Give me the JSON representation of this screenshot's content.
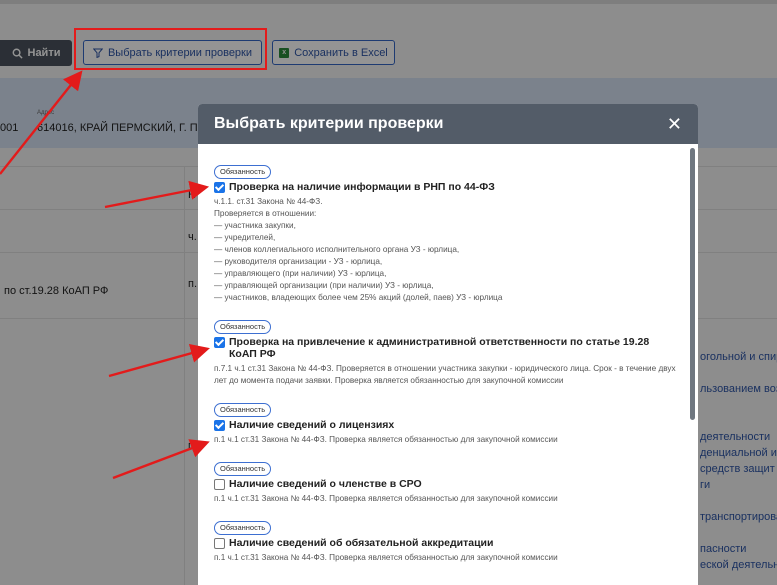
{
  "toolbar": {
    "find_label": "Найти",
    "criteria_label": "Выбрать критерии проверки",
    "excel_label": "Сохранить в Excel",
    "excel_icon_glyph": "x"
  },
  "info": {
    "left_number": "001",
    "address_caption": "Адрес",
    "address_value": "614016, КРАЙ ПЕРМСКИЙ, Г. ПЕ"
  },
  "background": {
    "col_header_short": "Н",
    "cell_ch": "ч.",
    "cell_p1": "п.",
    "cell_p2": "п.",
    "row_koap": "по ст.19.28 КоАП РФ",
    "links": [
      "огольной и спир",
      "льзованием возб",
      "деятельности",
      "денциальной ин",
      "средств защит",
      "ги",
      "транспортирова",
      "пасности",
      "еской деятельн"
    ]
  },
  "modal": {
    "title": "Выбрать критерии проверки",
    "close_glyph": "✕",
    "criteria": [
      {
        "badge": "Обязанность",
        "checked": true,
        "title": "Проверка на наличие информации в РНП по 44-ФЗ",
        "desc": "ч.1.1. ст.31 Закона № 44-ФЗ.\nПроверяется в отношении:\n— участника закупки,\n— учредителей,\n— членов коллегиального исполнительного органа УЗ - юрлица,\n— руководителя организации - УЗ - юрлица,\n— управляющего (при наличии) УЗ - юрлица,\n— управляющей организации (при наличии) УЗ - юрлица,\n— участников, владеющих более чем 25% акций (долей, паев) УЗ - юрлица"
      },
      {
        "badge": "Обязанность",
        "checked": true,
        "title": "Проверка на привлечение к административной ответственности по статье 19.28 КоАП РФ",
        "desc": "п.7.1 ч.1 ст.31 Закона № 44-ФЗ. Проверяется в отношении участника закупки - юридического лица. Срок - в течение двух лет до момента подачи заявки. Проверка является обязанностью для закупочной комиссии"
      },
      {
        "badge": "Обязанность",
        "checked": true,
        "title": "Наличие сведений о лицензиях",
        "desc": "п.1 ч.1 ст.31 Закона № 44-ФЗ. Проверка является обязанностью для закупочной комиссии"
      },
      {
        "badge": "Обязанность",
        "checked": false,
        "title": "Наличие сведений о членстве в СРО",
        "desc": "п.1 ч.1 ст.31 Закона № 44-ФЗ. Проверка является обязанностью для закупочной комиссии"
      },
      {
        "badge": "Обязанность",
        "checked": false,
        "title": "Наличие сведений об обязательной аккредитации",
        "desc": "п.1 ч.1 ст.31 Закона № 44-ФЗ. Проверка является обязанностью для закупочной комиссии"
      }
    ]
  },
  "colors": {
    "modal_header": "#535c68",
    "accent": "#3566c4",
    "checkbox": "#1a73e8",
    "annotation": "#e31b1b"
  }
}
